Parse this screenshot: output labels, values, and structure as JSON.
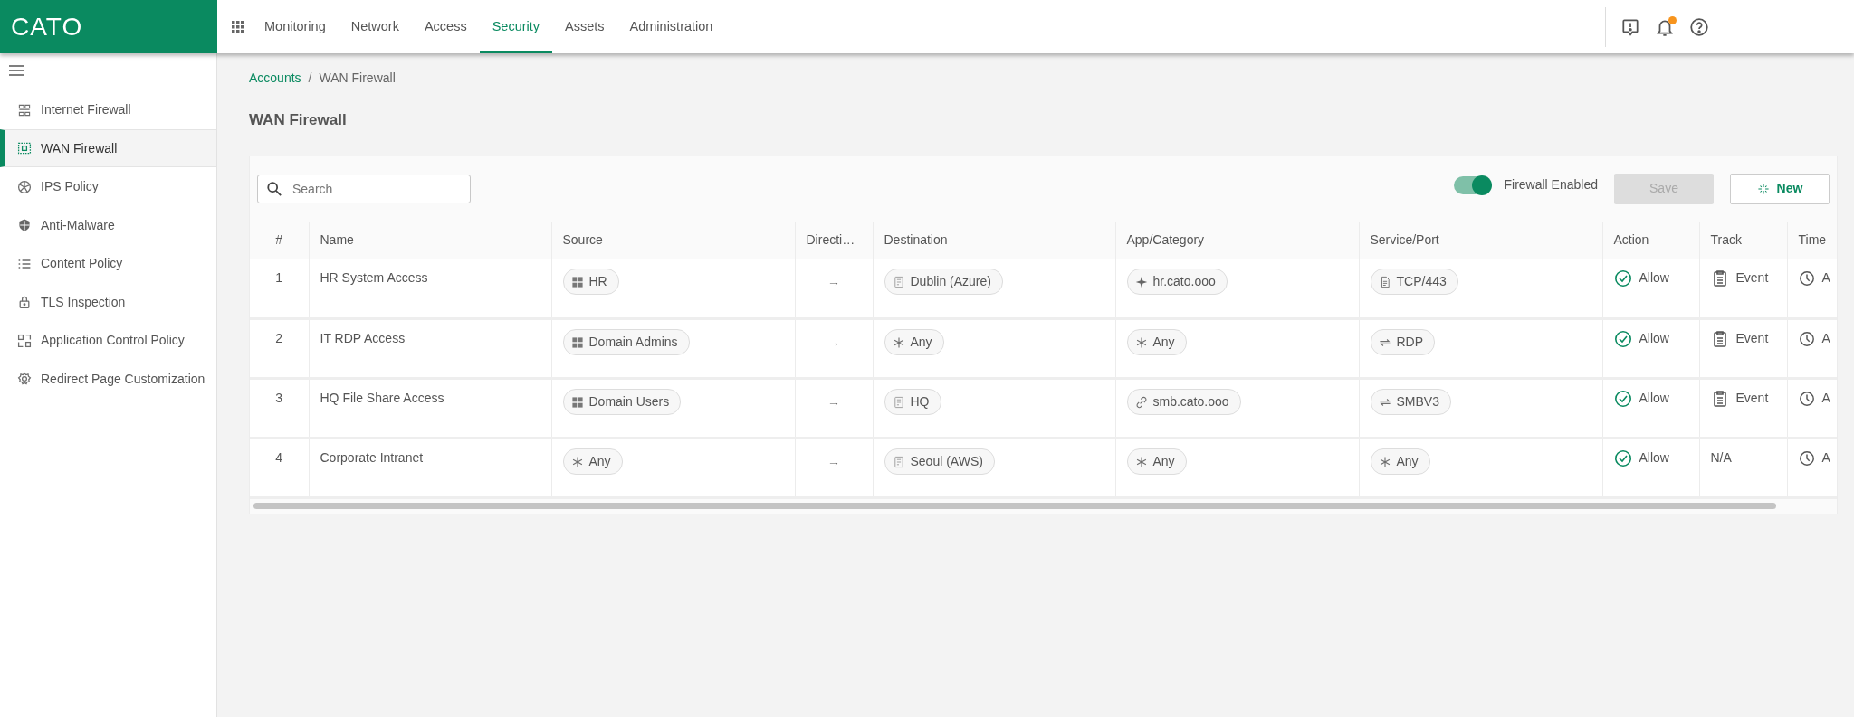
{
  "app": {
    "logo": "CATO"
  },
  "top_nav": [
    {
      "label": "Monitoring",
      "selected": false
    },
    {
      "label": "Network",
      "selected": false
    },
    {
      "label": "Access",
      "selected": false
    },
    {
      "label": "Security",
      "selected": true
    },
    {
      "label": "Assets",
      "selected": false
    },
    {
      "label": "Administration",
      "selected": false
    }
  ],
  "notifications": {
    "unread": true
  },
  "sidebar": {
    "items": [
      {
        "label": "Internet Firewall",
        "selected": false
      },
      {
        "label": "WAN Firewall",
        "selected": true
      },
      {
        "label": "IPS Policy",
        "selected": false
      },
      {
        "label": "Anti-Malware",
        "selected": false
      },
      {
        "label": "Content Policy",
        "selected": false
      },
      {
        "label": "TLS Inspection",
        "selected": false
      },
      {
        "label": "Application Control Policy",
        "selected": false
      },
      {
        "label": "Redirect Page Customization",
        "selected": false
      }
    ]
  },
  "breadcrumb": {
    "items": [
      "Accounts",
      "WAN Firewall"
    ],
    "separator": "/"
  },
  "page_title": "WAN Firewall",
  "toolbar": {
    "search": {
      "placeholder": "Search"
    },
    "toggle": {
      "label": "Firewall Enabled",
      "on": true
    },
    "save": {
      "label": "Save",
      "disabled": true
    },
    "new": {
      "label": "New"
    }
  },
  "table": {
    "columns": [
      "#",
      "Name",
      "Source",
      "Directi…",
      "Destination",
      "App/Category",
      "Service/Port",
      "Action",
      "Track",
      "Time"
    ],
    "rows": [
      {
        "number": "1",
        "name": "HR System Access",
        "source": {
          "kind": "group",
          "label": "HR"
        },
        "direction": "→",
        "destination": {
          "kind": "site",
          "label": "Dublin (Azure)"
        },
        "app": {
          "kind": "sparkle",
          "label": "hr.cato.ooo"
        },
        "service": {
          "kind": "file",
          "label": "TCP/443"
        },
        "action": "Allow",
        "track": {
          "kind": "event",
          "label": "Event"
        },
        "time": "A"
      },
      {
        "number": "2",
        "name": "IT RDP Access",
        "source": {
          "kind": "group",
          "label": "Domain Admins"
        },
        "direction": "→",
        "destination": {
          "kind": "any",
          "label": "Any"
        },
        "app": {
          "kind": "any",
          "label": "Any"
        },
        "service": {
          "kind": "protocol",
          "label": "RDP"
        },
        "action": "Allow",
        "track": {
          "kind": "event",
          "label": "Event"
        },
        "time": "A"
      },
      {
        "number": "3",
        "name": "HQ File Share Access",
        "source": {
          "kind": "group",
          "label": "Domain Users"
        },
        "direction": "→",
        "destination": {
          "kind": "site",
          "label": "HQ"
        },
        "app": {
          "kind": "link",
          "label": "smb.cato.ooo"
        },
        "service": {
          "kind": "protocol",
          "label": "SMBV3"
        },
        "action": "Allow",
        "track": {
          "kind": "event",
          "label": "Event"
        },
        "time": "A"
      },
      {
        "number": "4",
        "name": "Corporate Intranet",
        "source": {
          "kind": "any",
          "label": "Any"
        },
        "direction": "→",
        "destination": {
          "kind": "site",
          "label": "Seoul (AWS)"
        },
        "app": {
          "kind": "any",
          "label": "Any"
        },
        "service": {
          "kind": "any",
          "label": "Any"
        },
        "action": "Allow",
        "track": {
          "kind": "none",
          "label": "N/A"
        },
        "time": "A"
      }
    ]
  }
}
